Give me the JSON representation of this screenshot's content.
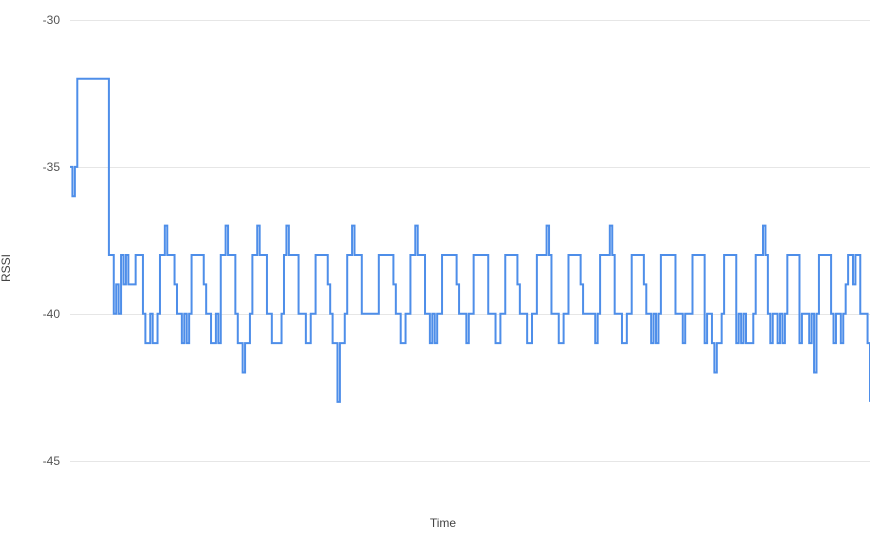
{
  "chart_data": {
    "type": "line",
    "xlabel": "Time",
    "ylabel": "RSSI",
    "ylim": [
      -46,
      -30
    ],
    "yticks": [
      -30,
      -35,
      -40,
      -45
    ],
    "x": [
      0,
      1,
      2,
      3,
      4,
      5,
      6,
      7,
      8,
      9,
      10,
      11,
      12,
      13,
      14,
      15,
      16,
      17,
      18,
      19,
      20,
      21,
      22,
      23,
      24,
      25,
      26,
      27,
      28,
      29,
      30,
      31,
      32,
      33,
      34,
      35,
      36,
      37,
      38,
      39,
      40,
      41,
      42,
      43,
      44,
      45,
      46,
      47,
      48,
      49,
      50,
      51,
      52,
      53,
      54,
      55,
      56,
      57,
      58,
      59,
      60,
      61,
      62,
      63,
      64,
      65,
      66,
      67,
      68,
      69,
      70,
      71,
      72,
      73,
      74,
      75,
      76,
      77,
      78,
      79,
      80,
      81,
      82,
      83,
      84,
      85,
      86,
      87,
      88,
      89,
      90,
      91,
      92,
      93,
      94,
      95,
      96,
      97,
      98,
      99,
      100,
      101,
      102,
      103,
      104,
      105,
      106,
      107,
      108,
      109,
      110,
      111,
      112,
      113,
      114,
      115,
      116,
      117,
      118,
      119,
      120,
      121,
      122,
      123,
      124,
      125,
      126,
      127,
      128,
      129,
      130,
      131,
      132,
      133,
      134,
      135,
      136,
      137,
      138,
      139,
      140,
      141,
      142,
      143,
      144,
      145,
      146,
      147,
      148,
      149,
      150,
      151,
      152,
      153,
      154,
      155,
      156,
      157,
      158,
      159,
      160,
      161,
      162,
      163,
      164,
      165,
      166,
      167,
      168,
      169,
      170,
      171,
      172,
      173,
      174,
      175,
      176,
      177,
      178,
      179,
      180,
      181,
      182,
      183,
      184,
      185,
      186,
      187,
      188,
      189,
      190,
      191,
      192,
      193,
      194,
      195,
      196,
      197,
      198,
      199,
      200,
      201,
      202,
      203,
      204,
      205,
      206,
      207,
      208,
      209,
      210,
      211,
      212,
      213,
      214,
      215,
      216,
      217,
      218,
      219,
      220,
      221,
      222,
      223,
      224,
      225,
      226,
      227,
      228,
      229,
      230,
      231,
      232,
      233,
      234,
      235,
      236,
      237,
      238,
      239,
      240,
      241,
      242,
      243,
      244,
      245,
      246,
      247,
      248,
      249,
      250,
      251,
      252,
      253,
      254,
      255,
      256,
      257,
      258,
      259,
      260,
      261,
      262,
      263,
      264,
      265,
      266,
      267,
      268,
      269,
      270,
      271,
      272,
      273,
      274,
      275,
      276,
      277,
      278,
      279,
      280,
      281,
      282,
      283,
      284,
      285,
      286,
      287,
      288,
      289,
      290,
      291,
      292,
      293,
      294,
      295,
      296,
      297,
      298,
      299,
      300,
      301,
      302,
      303,
      304,
      305,
      306,
      307,
      308,
      309,
      310,
      311,
      312,
      313,
      314,
      315,
      316,
      317,
      318,
      319,
      320,
      321,
      322,
      323,
      324,
      325,
      326,
      327,
      328,
      329
    ],
    "values": [
      -35,
      -36,
      -35,
      -32,
      -32,
      -32,
      -32,
      -32,
      -32,
      -32,
      -32,
      -32,
      -32,
      -32,
      -32,
      -32,
      -38,
      -38,
      -40,
      -39,
      -40,
      -38,
      -39,
      -38,
      -39,
      -39,
      -39,
      -38,
      -38,
      -38,
      -40,
      -41,
      -41,
      -40,
      -41,
      -41,
      -40,
      -38,
      -38,
      -37,
      -38,
      -38,
      -38,
      -39,
      -40,
      -40,
      -41,
      -40,
      -41,
      -40,
      -38,
      -38,
      -38,
      -38,
      -38,
      -39,
      -40,
      -40,
      -41,
      -41,
      -40,
      -41,
      -38,
      -38,
      -37,
      -38,
      -38,
      -38,
      -40,
      -41,
      -41,
      -42,
      -41,
      -41,
      -40,
      -38,
      -38,
      -37,
      -38,
      -38,
      -38,
      -40,
      -40,
      -41,
      -41,
      -41,
      -41,
      -40,
      -38,
      -37,
      -38,
      -38,
      -38,
      -38,
      -40,
      -40,
      -40,
      -41,
      -41,
      -40,
      -40,
      -38,
      -38,
      -38,
      -38,
      -38,
      -39,
      -40,
      -41,
      -41,
      -43,
      -41,
      -41,
      -40,
      -38,
      -38,
      -37,
      -38,
      -38,
      -38,
      -40,
      -40,
      -40,
      -40,
      -40,
      -40,
      -40,
      -38,
      -38,
      -38,
      -38,
      -38,
      -38,
      -39,
      -40,
      -40,
      -41,
      -41,
      -40,
      -40,
      -38,
      -38,
      -37,
      -38,
      -38,
      -38,
      -40,
      -40,
      -41,
      -40,
      -41,
      -40,
      -40,
      -38,
      -38,
      -38,
      -38,
      -38,
      -38,
      -39,
      -40,
      -40,
      -40,
      -41,
      -40,
      -40,
      -38,
      -38,
      -38,
      -38,
      -38,
      -38,
      -40,
      -40,
      -40,
      -41,
      -41,
      -40,
      -40,
      -38,
      -38,
      -38,
      -38,
      -38,
      -39,
      -40,
      -40,
      -40,
      -41,
      -41,
      -40,
      -40,
      -38,
      -38,
      -38,
      -38,
      -37,
      -38,
      -40,
      -40,
      -40,
      -41,
      -41,
      -40,
      -40,
      -38,
      -38,
      -38,
      -38,
      -38,
      -39,
      -40,
      -40,
      -40,
      -40,
      -40,
      -41,
      -40,
      -38,
      -38,
      -38,
      -38,
      -37,
      -38,
      -40,
      -40,
      -40,
      -41,
      -41,
      -40,
      -40,
      -38,
      -38,
      -38,
      -38,
      -38,
      -39,
      -40,
      -40,
      -41,
      -40,
      -41,
      -40,
      -38,
      -38,
      -38,
      -38,
      -38,
      -38,
      -40,
      -40,
      -40,
      -41,
      -40,
      -40,
      -40,
      -38,
      -38,
      -38,
      -38,
      -38,
      -41,
      -40,
      -40,
      -41,
      -42,
      -41,
      -41,
      -40,
      -38,
      -38,
      -38,
      -38,
      -38,
      -41,
      -40,
      -41,
      -40,
      -41,
      -41,
      -41,
      -40,
      -38,
      -38,
      -38,
      -37,
      -38,
      -40,
      -41,
      -40,
      -40,
      -41,
      -40,
      -41,
      -40,
      -38,
      -38,
      -38,
      -38,
      -38,
      -41,
      -40,
      -40,
      -40,
      -41,
      -40,
      -42,
      -40,
      -38,
      -38,
      -38,
      -38,
      -38,
      -40,
      -41,
      -40,
      -40,
      -41,
      -40,
      -39,
      -38,
      -38,
      -39,
      -38,
      -38,
      -40,
      -40,
      -40,
      -41,
      -43
    ],
    "title": "",
    "grid": true,
    "colors": {
      "series": "#4e8ee9",
      "grid": "#e6e6e6",
      "text": "#555555"
    }
  }
}
